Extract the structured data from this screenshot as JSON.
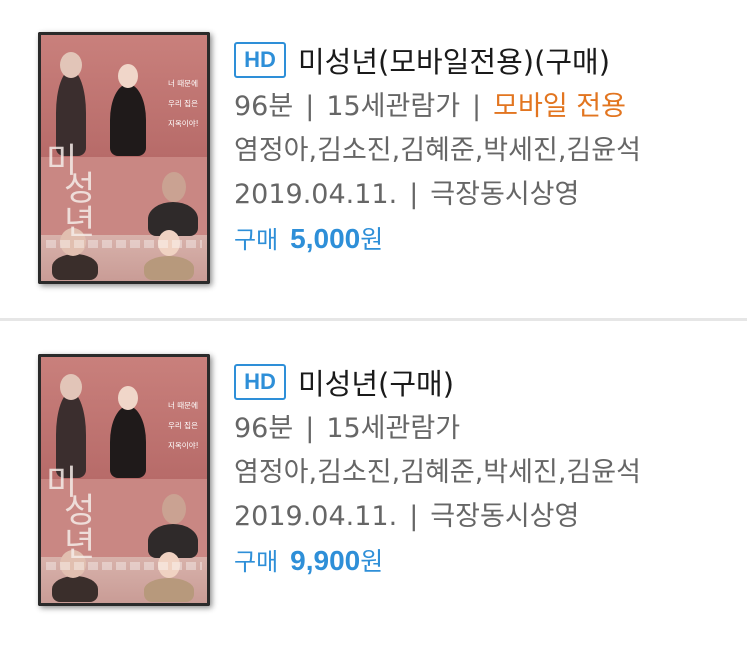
{
  "items": [
    {
      "badge": "HD",
      "title": "미성년(모바일전용)(구매)",
      "duration": "96분",
      "rating": "15세관람가",
      "mobile_only": "모바일 전용",
      "cast": "염정아,김소진,김혜준,박세진,김윤석",
      "release_date": "2019.04.11.",
      "release_note": "극장동시상영",
      "price_label": "구매",
      "price_value": "5,000",
      "price_unit": "원",
      "poster": {
        "tagline_1": "너 때문에",
        "tagline_2": "우리 집은",
        "tagline_3": "지옥이야!",
        "title_1": "미",
        "title_2": "성년"
      }
    },
    {
      "badge": "HD",
      "title": "미성년(구매)",
      "duration": "96분",
      "rating": "15세관람가",
      "cast": "염정아,김소진,김혜준,박세진,김윤석",
      "release_date": "2019.04.11.",
      "release_note": "극장동시상영",
      "price_label": "구매",
      "price_value": "9,900",
      "price_unit": "원",
      "poster": {
        "tagline_1": "너 때문에",
        "tagline_2": "우리 집은",
        "tagline_3": "지옥이야!",
        "title_1": "미",
        "title_2": "성년"
      }
    }
  ],
  "separator": "|",
  "colors": {
    "accent_blue": "#2e8fd8",
    "mobile_orange": "#e27520",
    "meta_gray": "#666666",
    "title_black": "#1a1a1a"
  }
}
